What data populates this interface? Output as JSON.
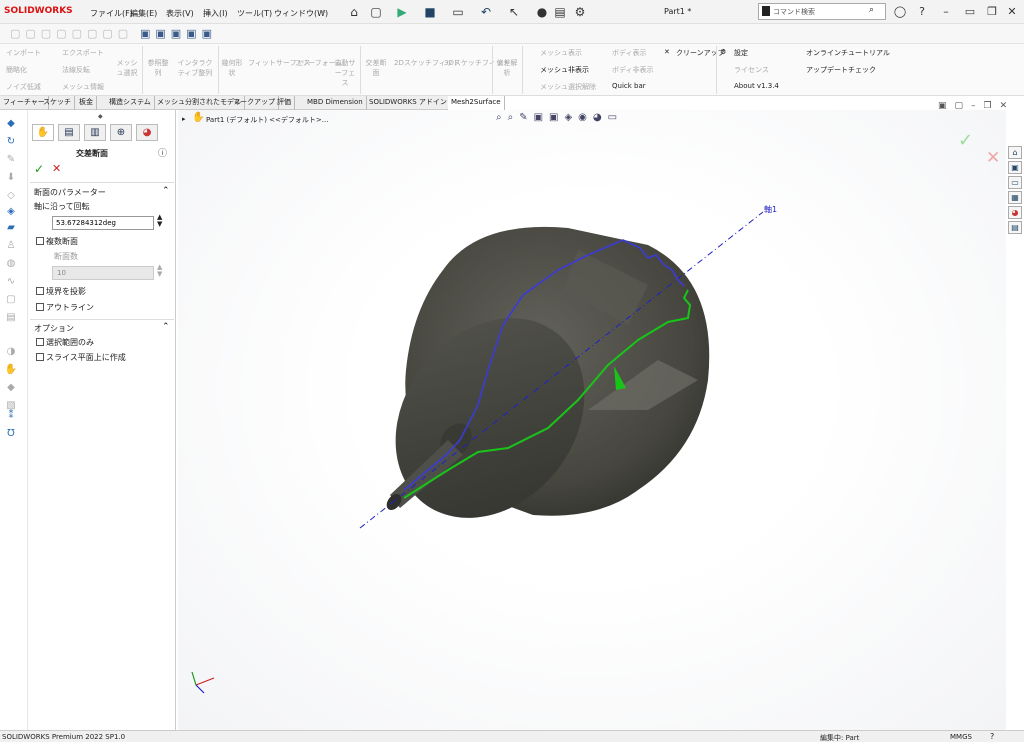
{
  "app": {
    "logo": "SOLIDWORKS",
    "doc_title": "Part1 *"
  },
  "menu": [
    "ファイル(F)",
    "編集(E)",
    "表示(V)",
    "挿入(I)",
    "ツール(T)",
    "ウィンドウ(W)"
  ],
  "search": {
    "placeholder": "コマンド検索"
  },
  "ribbon": {
    "col1": [
      "インポート",
      "簡略化",
      "ノイズ低減"
    ],
    "col2": [
      "エクスポート",
      "法線反転",
      "メッシュ情報"
    ],
    "col3": "メッシュ選択",
    "col4": "参照整列",
    "col5": "インタラクティブ整列",
    "col6": "幾何形状",
    "col7": "フィットサーフェス",
    "col8": "フリーフォーム",
    "col9": "自動サーフェス",
    "col10": "交差断面",
    "col11": "2Dスケッチフィット",
    "col12": "3Dスケッチフィット",
    "col13": "偏差解析",
    "mesh_col": [
      "メッシュ表示",
      "メッシュ非表示",
      "メッシュ選択解除"
    ],
    "body_col": [
      "ボディ表示",
      "ボディ非表示"
    ],
    "cleanup": "クリーンアップ",
    "quickbar": "Quick bar",
    "settings": "設定",
    "license": "ライセンス",
    "about": "About v1.3.4",
    "tutorial": "オンラインチュートリアル",
    "update": "アップデートチェック"
  },
  "tabs": [
    "フィーチャー",
    "スケッチ",
    "板金",
    "構造システム",
    "メッシュ分割されたモデル",
    "マークアップ",
    "評価",
    "MBD Dimension",
    "SOLIDWORKS アドイン",
    "Mesh2Surface"
  ],
  "pm": {
    "title": "交差断面",
    "params_header": "断面のパラメーター",
    "rotate_label": "軸に沿って回転",
    "rotate_value": "53.67284312deg",
    "multi_label": "複数断面",
    "count_label": "断面数",
    "count_value": "10",
    "project_label": "境界を投影",
    "outline_label": "アウトライン",
    "options_header": "オプション",
    "opt1": "選択範囲のみ",
    "opt2": "スライス平面上に作成"
  },
  "tree": {
    "item": "Part1 (デフォルト) <<デフォルト>..."
  },
  "viewport": {
    "axis_label": "軸1"
  },
  "status": {
    "left": "SOLIDWORKS Premium 2022 SP1.0",
    "mode": "編集中: Part",
    "units": "MMGS"
  },
  "colors": {
    "section_blue": "#3b3bd8",
    "section_green": "#19c419",
    "body": "#4a4a44",
    "axis": "#2020c8"
  }
}
